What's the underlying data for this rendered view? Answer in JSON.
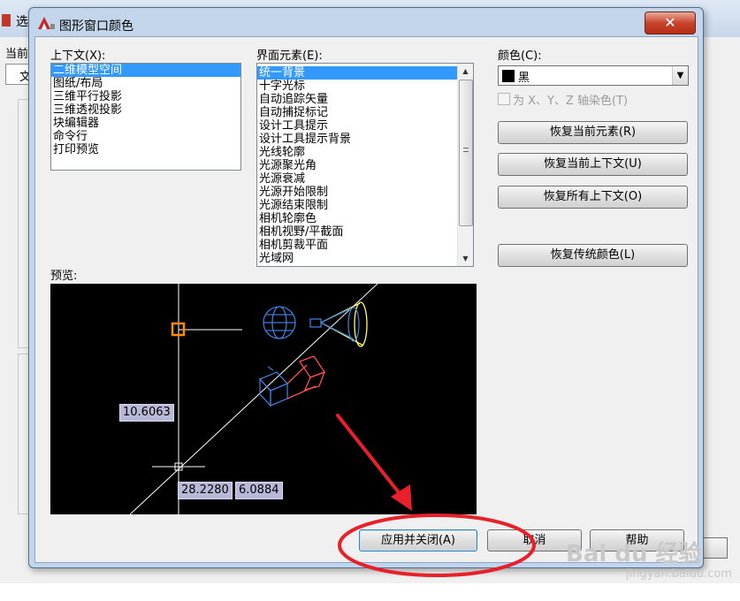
{
  "background_window": {
    "title": "选",
    "label": "当前",
    "tab_label": "文"
  },
  "dialog": {
    "title": "图形窗口颜色",
    "close_glyph": "✕",
    "context": {
      "label": "上下文(X):",
      "items": [
        "二维模型空间",
        "图纸/布局",
        "三维平行投影",
        "三维透视投影",
        "块编辑器",
        "命令行",
        "打印预览"
      ],
      "selected_index": 0
    },
    "interface_elements": {
      "label": "界面元素(E):",
      "items": [
        "统一背景",
        "十字光标",
        "自动追踪矢量",
        "自动捕捉标记",
        "设计工具提示",
        "设计工具提示背景",
        "光线轮廓",
        "光源聚光角",
        "光源衰减",
        "光源开始限制",
        "光源结束限制",
        "相机轮廓色",
        "相机视野/平截面",
        "相机剪裁平面",
        "光域网"
      ],
      "selected_index": 0
    },
    "color": {
      "label": "颜色(C):",
      "value": "黑",
      "swatch": "#000000",
      "tint_checkbox_label": "为 X、Y、Z 轴染色(T)"
    },
    "buttons": {
      "restore_element": "恢复当前元素(R)",
      "restore_context": "恢复当前上下文(U)",
      "restore_all": "恢复所有上下文(O)",
      "restore_classic": "恢复传统颜色(L)",
      "apply_close": "应用并关闭(A)",
      "cancel": "取消",
      "help": "帮助"
    },
    "preview": {
      "label": "预览:",
      "measure_1": "10.6063",
      "measure_2": "28.2280",
      "measure_3": "6.0884"
    }
  },
  "watermark": {
    "brand": "Bai du 经验",
    "url": "jingyan.baidu.com"
  },
  "colors": {
    "selection": "#3399ff",
    "annotation_red": "#e8202a",
    "snap_marker": "#ff8c00",
    "light_yellow": "#ffff66",
    "camera_blue": "#3a7bd5"
  }
}
